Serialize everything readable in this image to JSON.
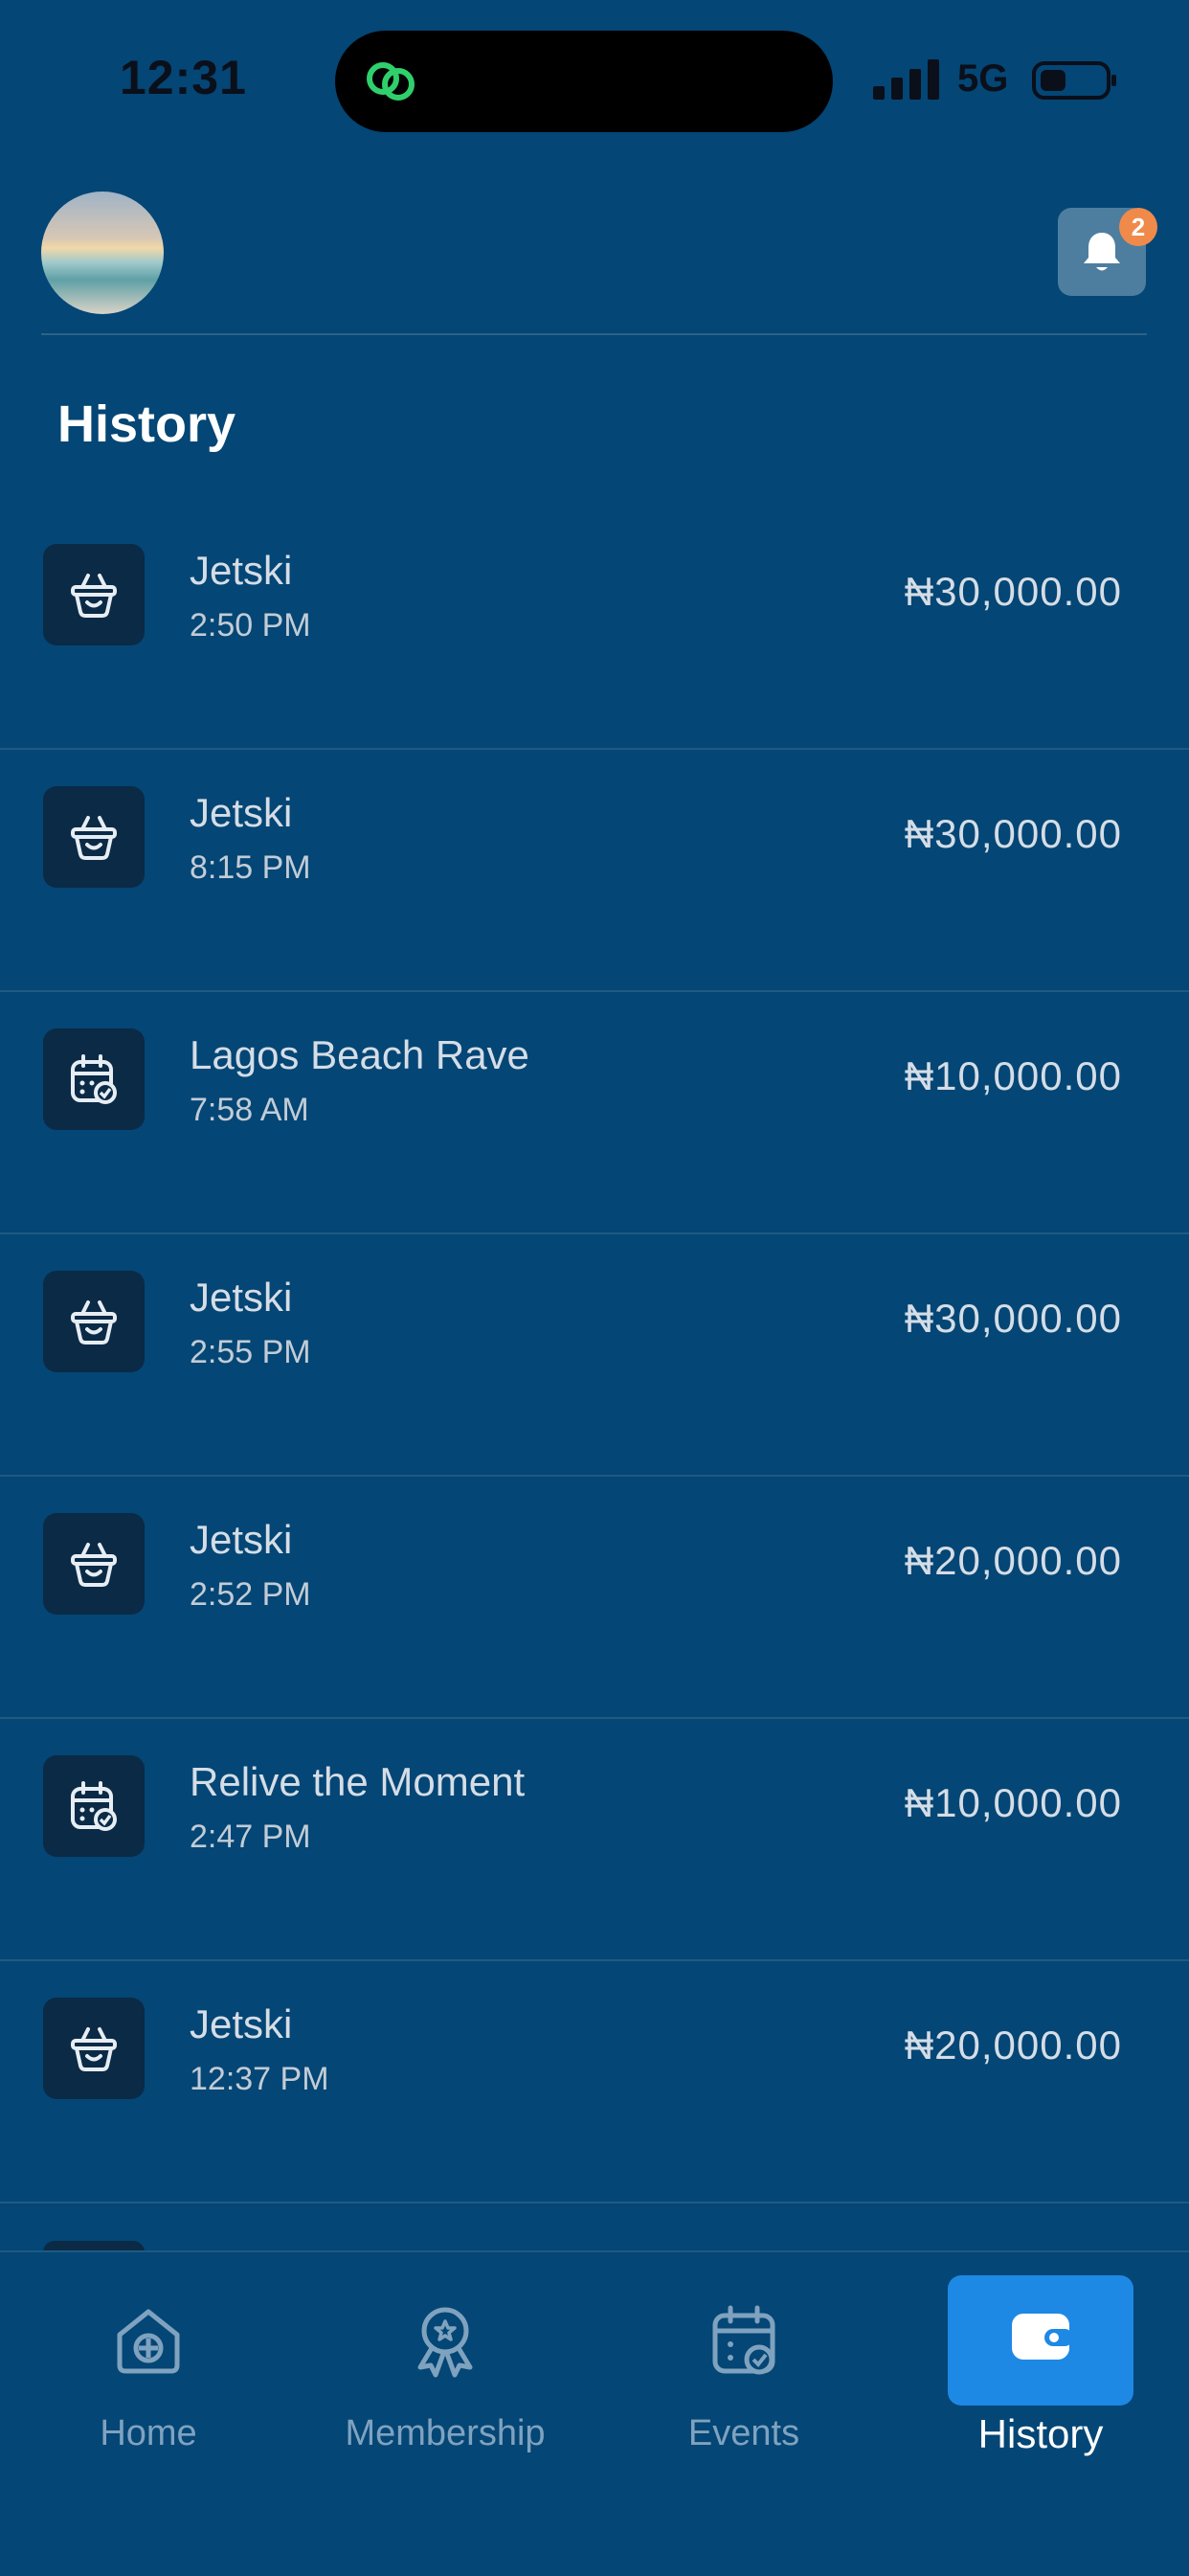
{
  "status_bar": {
    "time": "12:31",
    "network": "5G",
    "icons": [
      "link-icon",
      "signal-icon",
      "battery-icon"
    ]
  },
  "header": {
    "avatar": "avatar",
    "notification_count": "2",
    "bell_icon": "bell-icon"
  },
  "page_title": "History",
  "history": [
    {
      "title": "Jetski",
      "time": "2:50 PM",
      "amount": "₦30,000.00",
      "icon": "basket-icon"
    },
    {
      "title": "Jetski",
      "time": "8:15 PM",
      "amount": "₦30,000.00",
      "icon": "basket-icon"
    },
    {
      "title": "Lagos Beach Rave",
      "time": "7:58 AM",
      "amount": "₦10,000.00",
      "icon": "calendar-icon"
    },
    {
      "title": "Jetski",
      "time": "2:55 PM",
      "amount": "₦30,000.00",
      "icon": "basket-icon"
    },
    {
      "title": "Jetski",
      "time": "2:52 PM",
      "amount": "₦20,000.00",
      "icon": "basket-icon"
    },
    {
      "title": "Relive the Moment",
      "time": "2:47 PM",
      "amount": "₦10,000.00",
      "icon": "calendar-icon"
    },
    {
      "title": "Jetski",
      "time": "12:37 PM",
      "amount": "₦20,000.00",
      "icon": "basket-icon"
    }
  ],
  "nav": {
    "items": [
      {
        "label": "Home",
        "icon": "home-icon"
      },
      {
        "label": "Membership",
        "icon": "award-icon"
      },
      {
        "label": "Events",
        "icon": "calendar-icon"
      },
      {
        "label": "History",
        "icon": "wallet-icon",
        "active": true
      }
    ]
  },
  "colors": {
    "background": "#044675",
    "accent": "#1e88e5",
    "badge": "#f08a4b",
    "icon_tile": "#0b2a46"
  }
}
